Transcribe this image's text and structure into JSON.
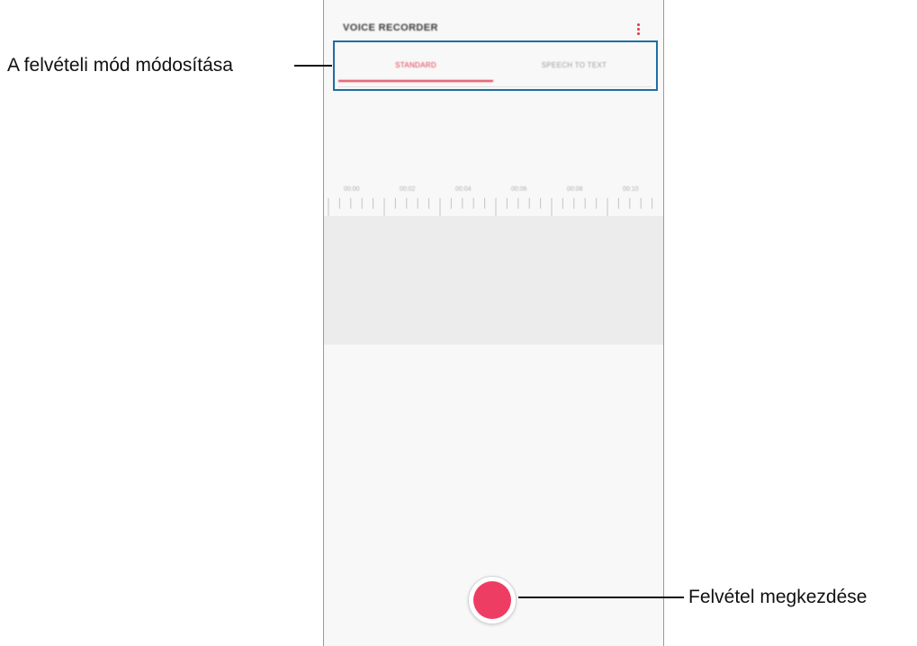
{
  "app": {
    "title": "VOICE RECORDER",
    "menu_icon": "more-vertical-icon"
  },
  "tabs": [
    {
      "label": "STANDARD",
      "selected": true
    },
    {
      "label": "SPEECH TO TEXT",
      "selected": false
    }
  ],
  "timeline": {
    "labels": [
      "00:00",
      "00:02",
      "00:04",
      "00:06",
      "00:08",
      "00:10"
    ]
  },
  "record_button": {
    "icon": "record-icon",
    "color": "#ee3d62"
  },
  "callouts": {
    "mode_change": "A felvételi mód módosítása",
    "start_recording": "Felvétel megkezdése"
  },
  "colors": {
    "accent": "#e0364a",
    "highlight_box": "#1d6fa5",
    "wave_background": "#ececec"
  }
}
